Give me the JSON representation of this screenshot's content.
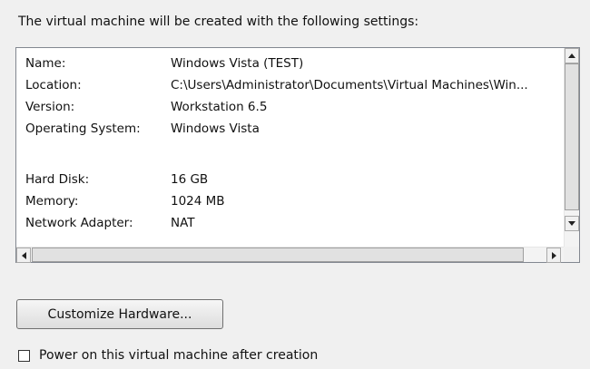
{
  "intro_text": "The virtual machine will be created with the following settings:",
  "settings": [
    {
      "label": "Name:",
      "value": "Windows Vista (TEST)"
    },
    {
      "label": "Location:",
      "value": "C:\\Users\\Administrator\\Documents\\Virtual Machines\\Win..."
    },
    {
      "label": "Version:",
      "value": "Workstation 6.5"
    },
    {
      "label": "Operating System:",
      "value": "Windows Vista"
    },
    {
      "label": "Hard Disk:",
      "value": "16 GB"
    },
    {
      "label": "Memory:",
      "value": "1024 MB"
    },
    {
      "label": "Network Adapter:",
      "value": "NAT"
    }
  ],
  "customize_button_label": "Customize Hardware...",
  "power_on_checkbox": {
    "label": "Power on this virtual machine after creation",
    "checked": false
  }
}
